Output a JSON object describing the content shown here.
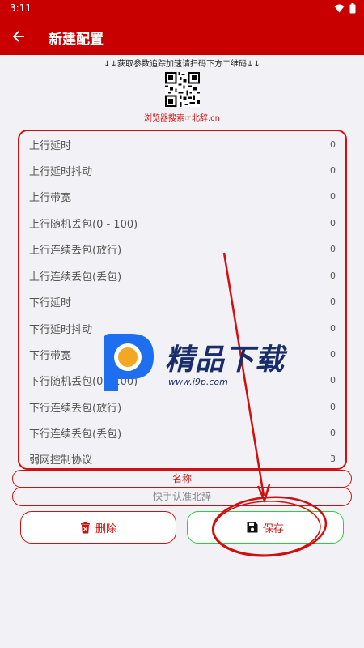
{
  "status_bar": {
    "time": "3:11"
  },
  "app_bar": {
    "title": "新建配置"
  },
  "hint": "↓↓获取参数追踪加速请扫码下方二维码↓↓",
  "search_hint": "浏览器搜索☞北辞.cn",
  "settings": [
    {
      "label": "上行延时",
      "value": "0"
    },
    {
      "label": "上行延时抖动",
      "value": "0"
    },
    {
      "label": "上行带宽",
      "value": "0"
    },
    {
      "label": "上行随机丢包(0 - 100)",
      "value": "0"
    },
    {
      "label": "上行连续丢包(放行)",
      "value": "0"
    },
    {
      "label": "上行连续丢包(丢包)",
      "value": "0"
    },
    {
      "label": "下行延时",
      "value": "0"
    },
    {
      "label": "下行延时抖动",
      "value": "0"
    },
    {
      "label": "下行带宽",
      "value": "0"
    },
    {
      "label": "下行随机丢包(0 - 100)",
      "value": "0"
    },
    {
      "label": "下行连续丢包(放行)",
      "value": "0"
    },
    {
      "label": "下行连续丢包(丢包)",
      "value": "0"
    },
    {
      "label": "弱网控制协议",
      "value": "3"
    }
  ],
  "name_section": {
    "label": "名称",
    "value": "快手认准北辞"
  },
  "buttons": {
    "delete": "删除",
    "save": "保存"
  },
  "watermark": {
    "text": "精品下载",
    "url": "www.j9p.com"
  },
  "colors": {
    "primary": "#c80000",
    "accent_red": "#d01010",
    "save_border": "#2ecc40",
    "background": "#f2f1f5"
  }
}
